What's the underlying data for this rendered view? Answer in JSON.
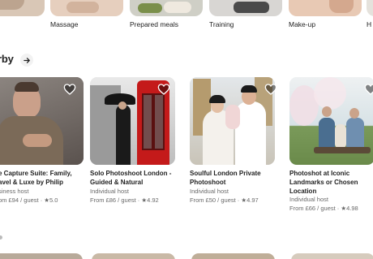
{
  "categories": [
    {
      "label": "Massage"
    },
    {
      "label": "Prepared meals"
    },
    {
      "label": "Training"
    },
    {
      "label": "Make-up"
    },
    {
      "label": "H"
    }
  ],
  "section": {
    "title": "rby"
  },
  "cards": [
    {
      "title": "e Capture Suite: Family, avel & Luxe by Philip",
      "host": "siness host",
      "price": "om £94 / guest · ★5.0"
    },
    {
      "title": "Solo Photoshoot London - Guided & Natural",
      "host": "Individual host",
      "price": "From £86 / guest · ★4.92"
    },
    {
      "title": "Soulful London Private Photoshoot",
      "host": "Individual host",
      "price": "From £50 / guest · ★4.97"
    },
    {
      "title": "Photoshot at Iconic Landmarks or Chosen Location",
      "host": "Individual host",
      "price": "From £66 / guest · ★4.98"
    }
  ],
  "colors": {
    "text": "#222222",
    "muted": "#6a6a6a",
    "heart_fill": "#3a3a3a",
    "phone_box": "#c41a1a"
  },
  "icons": {
    "section_arrow": "arrow-right-icon",
    "favorite": "heart-icon"
  }
}
